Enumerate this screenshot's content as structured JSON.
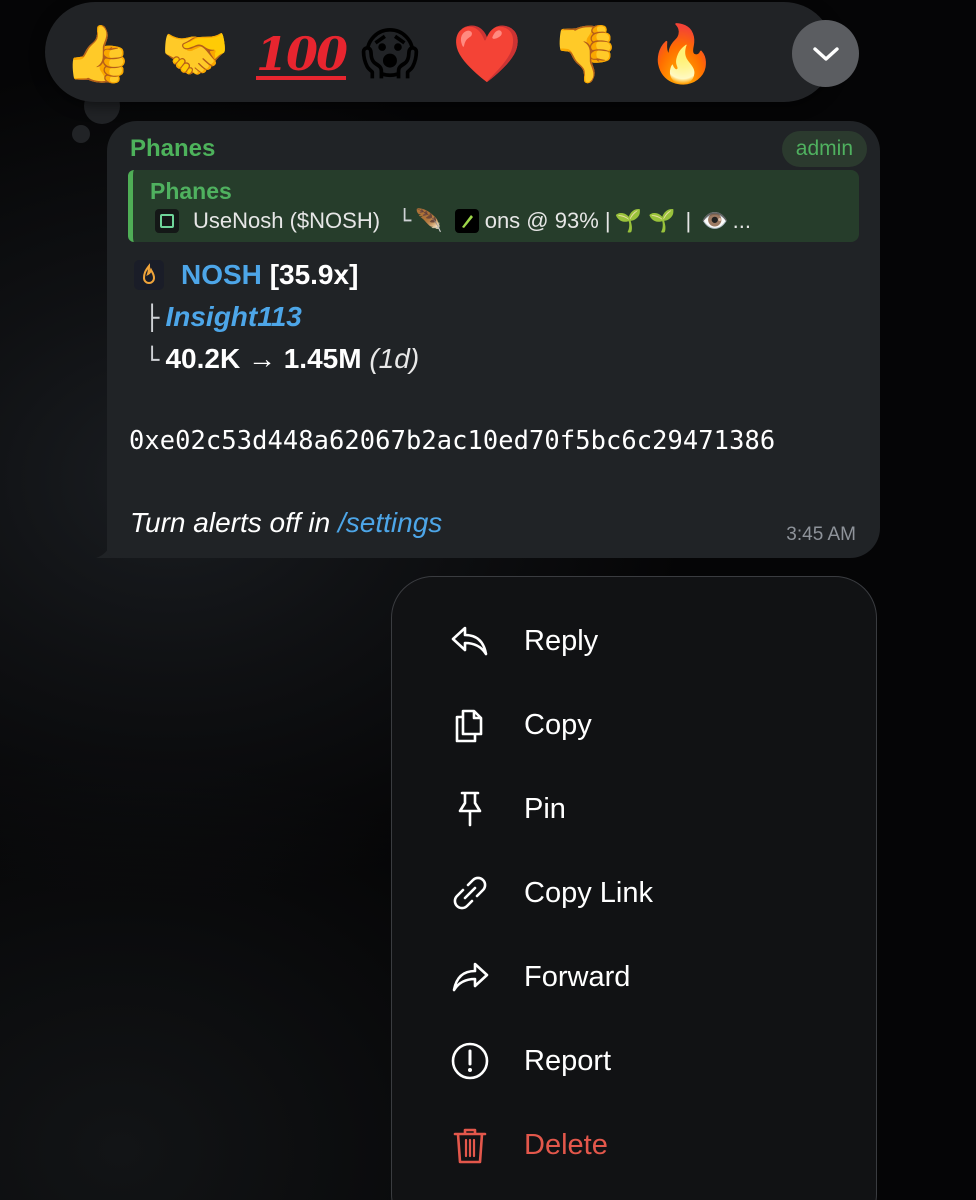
{
  "reactions": [
    {
      "emoji": "👍",
      "name": "thumbs-up"
    },
    {
      "emoji": "🤝",
      "name": "handshake"
    },
    {
      "emoji": "100",
      "name": "hundred-points"
    },
    {
      "emoji": "😱",
      "name": "scream"
    },
    {
      "emoji": "❤️",
      "name": "red-heart"
    },
    {
      "emoji": "👎",
      "name": "thumbs-down"
    },
    {
      "emoji": "🔥",
      "name": "fire"
    }
  ],
  "message": {
    "sender": "Phanes",
    "badge": "admin",
    "quote": {
      "name": "Phanes",
      "text_start": "UseNosh ($NOSH)",
      "tree_glyph": "└",
      "feather_emoji": "🪶",
      "text_mid": "ons @ 93% |",
      "sprouts": "🌱 🌱",
      "separator": "|",
      "eye_emoji": "👁️",
      "ellipsis": "..."
    },
    "ticker": "NOSH",
    "multiplier": "[35.9x]",
    "tree_branch": "├",
    "tree_end": "└",
    "handle": "Insight113",
    "mcap_change": "40.2K → 1.45M",
    "period": "(1d)",
    "address": "0xe02c53d448a62067b2ac10ed70f5bc6c29471386",
    "footer_prefix": "Turn alerts off in",
    "footer_link": "/settings",
    "time": "3:45 AM"
  },
  "menu": {
    "reply": "Reply",
    "copy": "Copy",
    "pin": "Pin",
    "copy_link": "Copy Link",
    "forward": "Forward",
    "report": "Report",
    "delete": "Delete"
  },
  "colors": {
    "sender_green": "#4db25b",
    "link_blue": "#4da6e8",
    "danger_red": "#e3574b",
    "bubble_bg": "#202326",
    "menu_bg": "#111214"
  }
}
